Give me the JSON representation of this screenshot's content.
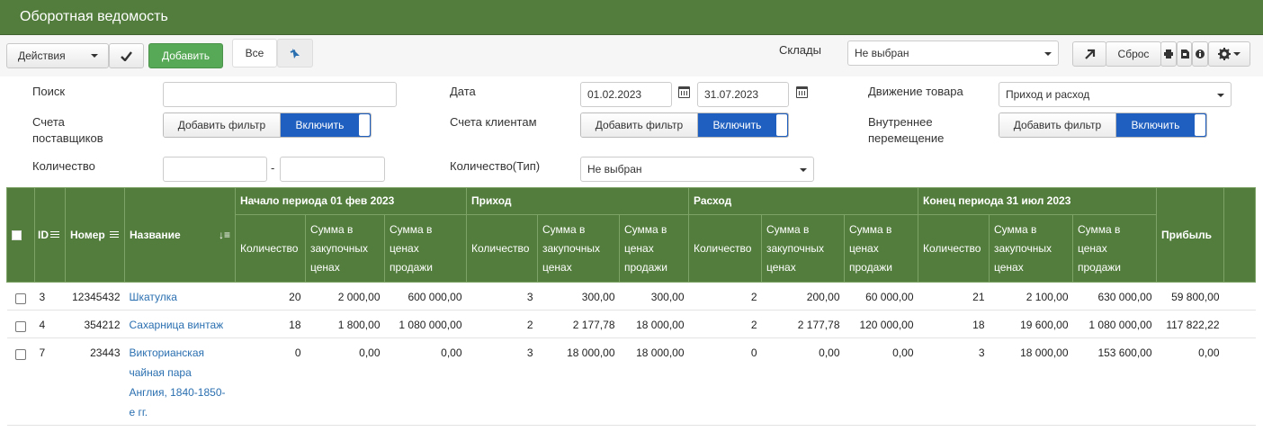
{
  "title": "Оборотная ведомость",
  "toolbar": {
    "actions_label": "Действия",
    "add_label": "Добавить",
    "all_label": "Все",
    "warehouses_label": "Склады",
    "warehouses_value": "Не выбран",
    "reset_label": "Сброс"
  },
  "filters": {
    "search_label": "Поиск",
    "search_value": "",
    "date_label": "Дата",
    "date_from": "01.02.2023",
    "date_to": "31.07.2023",
    "movement_label": "Движение товара",
    "movement_value": "Приход и расход",
    "supplier_label": "Счета поставщиков",
    "client_label": "Счета клиентам",
    "internal_label": "Внутреннее перемещение",
    "add_filter_label": "Добавить фильтр",
    "enable_label": "Включить",
    "qty_label": "Количество",
    "qty_dash": "-",
    "qty_type_label": "Количество(Тип)",
    "qty_type_value": "Не выбран"
  },
  "table": {
    "headers": {
      "id": "ID",
      "number": "Номер",
      "name": "Название",
      "start_group": "Начало периода 01 фев 2023",
      "income_group": "Приход",
      "expense_group": "Расход",
      "end_group": "Конец периода 31 июл 2023",
      "profit": "Прибыль",
      "qty": "Количество",
      "sum_purchase": "Сумма в закупочных ценах",
      "sum_sale": "Сумма в ценах продажи"
    },
    "rows": [
      {
        "id": "3",
        "number": "12345432",
        "name": "Шкатулка",
        "s_qty": "20",
        "s_pur": "2 000,00",
        "s_sale": "600 000,00",
        "i_qty": "3",
        "i_pur": "300,00",
        "i_sale": "300,00",
        "e_qty": "2",
        "e_pur": "200,00",
        "e_sale": "60 000,00",
        "c_qty": "21",
        "c_pur": "2 100,00",
        "c_sale": "630 000,00",
        "profit": "59 800,00"
      },
      {
        "id": "4",
        "number": "354212",
        "name": "Сахарница винтаж",
        "s_qty": "18",
        "s_pur": "1 800,00",
        "s_sale": "1 080 000,00",
        "i_qty": "2",
        "i_pur": "2 177,78",
        "i_sale": "18 000,00",
        "e_qty": "2",
        "e_pur": "2 177,78",
        "e_sale": "120 000,00",
        "c_qty": "18",
        "c_pur": "19 600,00",
        "c_sale": "1 080 000,00",
        "profit": "117 822,22"
      },
      {
        "id": "7",
        "number": "23443",
        "name": "Викторианская чайная пара Англия, 1840-1850-е гг.",
        "s_qty": "0",
        "s_pur": "0,00",
        "s_sale": "0,00",
        "i_qty": "3",
        "i_pur": "18 000,00",
        "i_sale": "18 000,00",
        "e_qty": "0",
        "e_pur": "0,00",
        "e_sale": "0,00",
        "c_qty": "3",
        "c_pur": "18 000,00",
        "c_sale": "153 600,00",
        "profit": "0,00"
      }
    ]
  }
}
